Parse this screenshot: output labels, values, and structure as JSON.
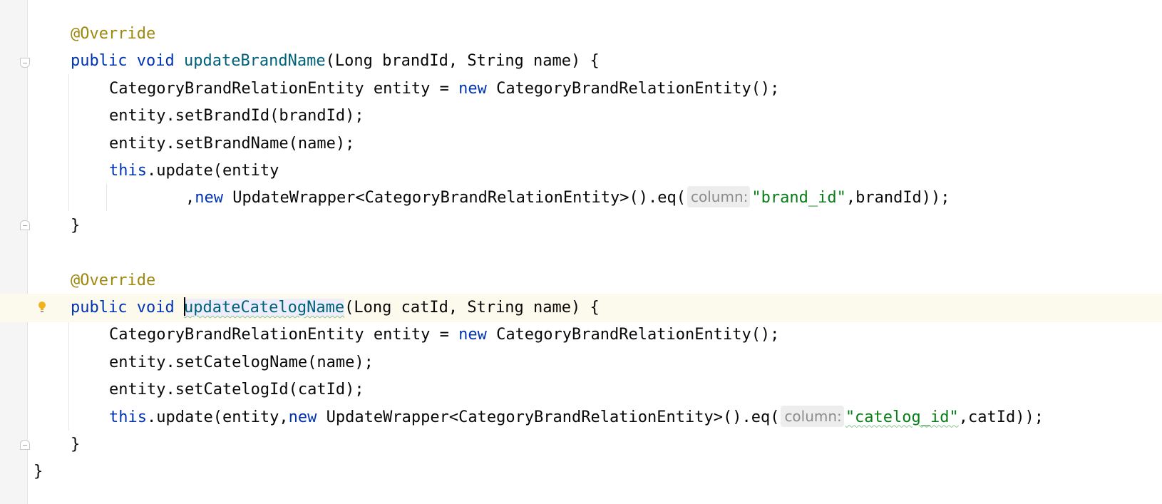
{
  "editor": {
    "lines": [
      {
        "id": "l1",
        "indent": 1,
        "parts": [
          {
            "t": "@Override",
            "c": "ann"
          }
        ]
      },
      {
        "id": "l2",
        "indent": 1,
        "parts": [
          {
            "t": "public",
            "c": "kw"
          },
          {
            "t": " "
          },
          {
            "t": "void",
            "c": "kw"
          },
          {
            "t": " "
          },
          {
            "t": "updateBrandName",
            "c": "fn"
          },
          {
            "t": "(Long brandId, String name) {"
          }
        ]
      },
      {
        "id": "l3",
        "indent": 2,
        "parts": [
          {
            "t": "CategoryBrandRelationEntity entity = "
          },
          {
            "t": "new",
            "c": "kw"
          },
          {
            "t": " CategoryBrandRelationEntity();"
          }
        ]
      },
      {
        "id": "l4",
        "indent": 2,
        "parts": [
          {
            "t": "entity.setBrandId(brandId);"
          }
        ]
      },
      {
        "id": "l5",
        "indent": 2,
        "parts": [
          {
            "t": "entity.setBrandName(name);"
          }
        ]
      },
      {
        "id": "l6",
        "indent": 2,
        "parts": [
          {
            "t": "this",
            "c": "kw"
          },
          {
            "t": ".update(entity"
          }
        ]
      },
      {
        "id": "l7",
        "indent": 4,
        "parts": [
          {
            "t": ","
          },
          {
            "t": "new",
            "c": "kw"
          },
          {
            "t": " UpdateWrapper<CategoryBrandRelationEntity>().eq("
          },
          {
            "t": "column:",
            "c": "hint"
          },
          {
            "t": "\"brand_id\"",
            "c": "str"
          },
          {
            "t": ",brandId));"
          }
        ]
      },
      {
        "id": "l8",
        "indent": 1,
        "parts": [
          {
            "t": "}"
          }
        ]
      },
      {
        "id": "l9",
        "indent": 0,
        "parts": []
      },
      {
        "id": "l10",
        "indent": 1,
        "parts": [
          {
            "t": "@Override",
            "c": "ann"
          }
        ]
      },
      {
        "id": "l11",
        "indent": 1,
        "current": true,
        "parts": [
          {
            "t": "public",
            "c": "kw"
          },
          {
            "t": " "
          },
          {
            "t": "void",
            "c": "kw"
          },
          {
            "t": " "
          },
          {
            "t": "",
            "c": "caret"
          },
          {
            "t": "updateCatelogName",
            "c": "fn sel-word typo"
          },
          {
            "t": "(Long catId, String name) {"
          }
        ]
      },
      {
        "id": "l12",
        "indent": 2,
        "parts": [
          {
            "t": "CategoryBrandRelationEntity entity = "
          },
          {
            "t": "new",
            "c": "kw"
          },
          {
            "t": " CategoryBrandRelationEntity();"
          }
        ]
      },
      {
        "id": "l13",
        "indent": 2,
        "parts": [
          {
            "t": "entity.setCatelogName(name);"
          }
        ]
      },
      {
        "id": "l14",
        "indent": 2,
        "parts": [
          {
            "t": "entity.setCatelogId(catId);"
          }
        ]
      },
      {
        "id": "l15",
        "indent": 2,
        "parts": [
          {
            "t": "this",
            "c": "kw"
          },
          {
            "t": ".update(entity,"
          },
          {
            "t": "new",
            "c": "kw"
          },
          {
            "t": " UpdateWrapper<CategoryBrandRelationEntity>().eq("
          },
          {
            "t": "column:",
            "c": "hint"
          },
          {
            "t": "\"catelog_id\"",
            "c": "str typo"
          },
          {
            "t": ",catId));"
          }
        ]
      },
      {
        "id": "l16",
        "indent": 1,
        "parts": [
          {
            "t": "}"
          }
        ]
      },
      {
        "id": "l17",
        "indent": 0,
        "parts": [
          {
            "t": "}"
          }
        ]
      }
    ]
  },
  "icons": {
    "bulb": "lightbulb-icon",
    "fold": "fold-marker-icon"
  }
}
